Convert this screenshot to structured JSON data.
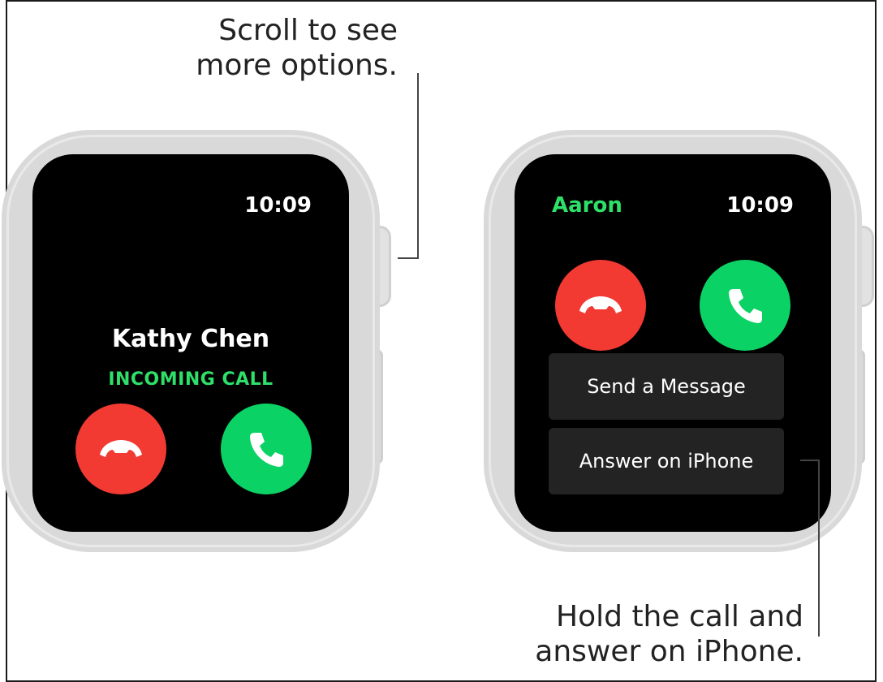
{
  "captions": {
    "scroll_line1": "Scroll to see",
    "scroll_line2": "more options.",
    "hold_line1": "Hold the call and",
    "hold_line2": "answer on iPhone."
  },
  "watch_incoming": {
    "time": "10:09",
    "caller_name": "Kathy Chen",
    "status": "INCOMING CALL",
    "decline_icon": "phone-hangup-icon",
    "answer_icon": "phone-answer-icon"
  },
  "watch_options": {
    "contact": "Aaron",
    "time": "10:09",
    "decline_icon": "phone-hangup-icon",
    "answer_icon": "phone-answer-icon",
    "options": [
      "Send a Message",
      "Answer on iPhone"
    ]
  },
  "colors": {
    "accent_green": "#2ee06a",
    "answer_green": "#0bd265",
    "decline_red": "#f23a33",
    "button_gray": "#232323"
  }
}
